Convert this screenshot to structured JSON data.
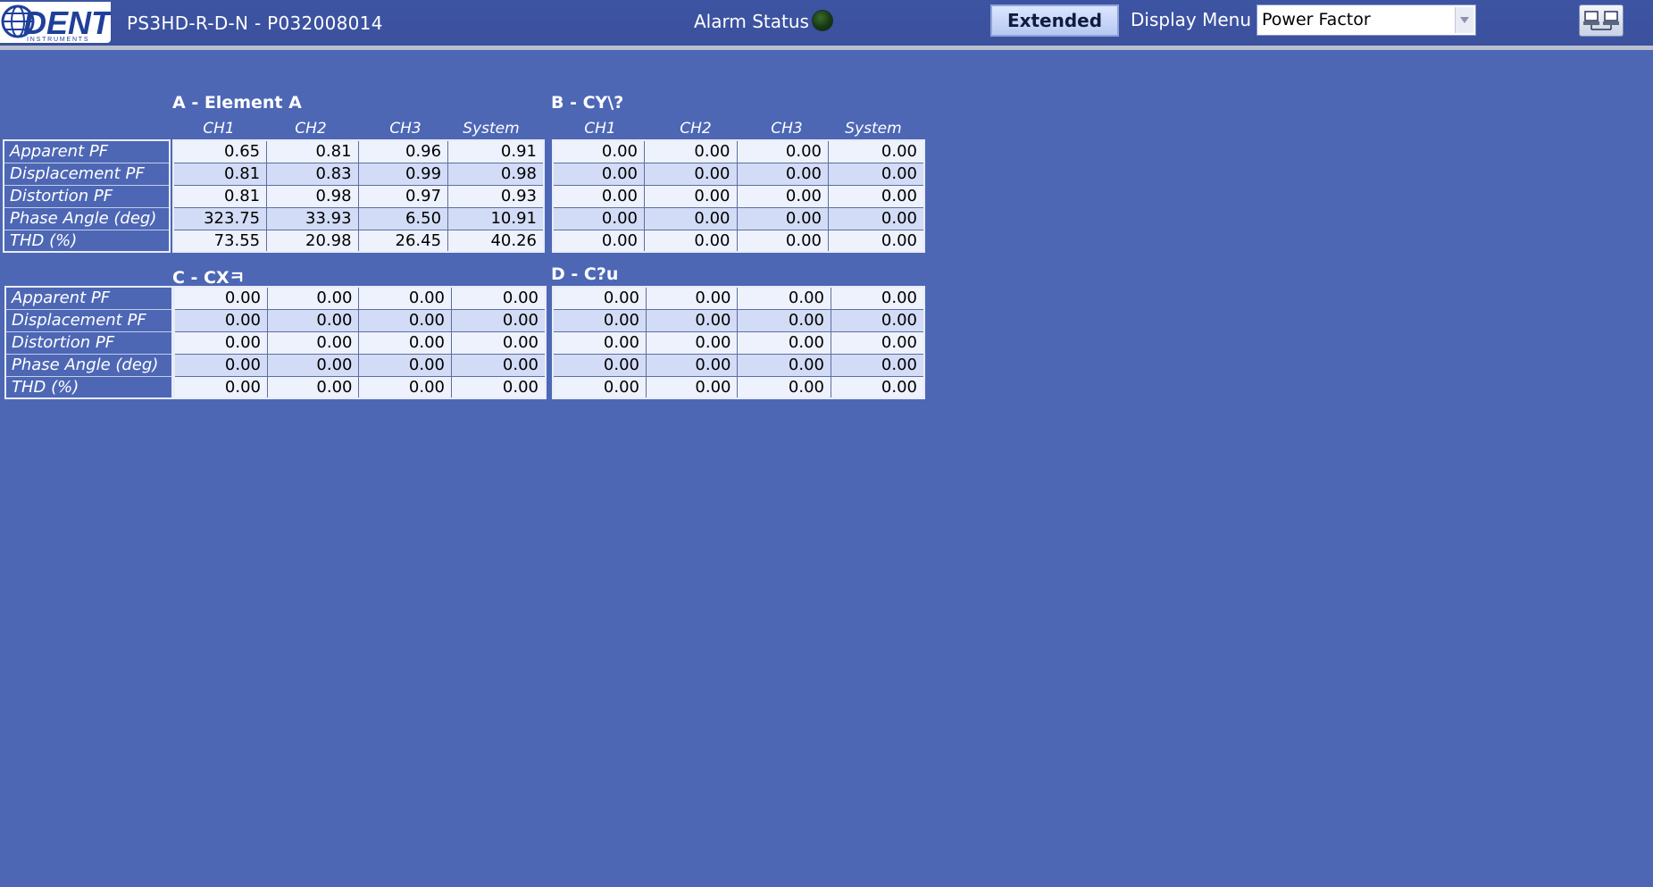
{
  "header": {
    "logo_text": "DENT",
    "logo_subtext": "INSTRUMENTS",
    "device_title": "PS3HD-R-D-N - P032008014",
    "alarm_label": "Alarm Status",
    "extended_label": "Extended",
    "display_menu_label": "Display Menu",
    "display_menu_value": "Power Factor",
    "alarm_led_color": "#173a12"
  },
  "row_labels": [
    "Apparent PF",
    "Displacement PF",
    "Distortion PF",
    "Phase Angle (deg)",
    "THD (%)"
  ],
  "col_headers": [
    "CH1",
    "CH2",
    "CH3",
    "System"
  ],
  "elements": {
    "a": {
      "title": "A - Element A",
      "rows": [
        [
          "0.65",
          "0.81",
          "0.96",
          "0.91"
        ],
        [
          "0.81",
          "0.83",
          "0.99",
          "0.98"
        ],
        [
          "0.81",
          "0.98",
          "0.97",
          "0.93"
        ],
        [
          "323.75",
          "33.93",
          "6.50",
          "10.91"
        ],
        [
          "73.55",
          "20.98",
          "26.45",
          "40.26"
        ]
      ]
    },
    "b": {
      "title": "B - CY\\?",
      "rows": [
        [
          "0.00",
          "0.00",
          "0.00",
          "0.00"
        ],
        [
          "0.00",
          "0.00",
          "0.00",
          "0.00"
        ],
        [
          "0.00",
          "0.00",
          "0.00",
          "0.00"
        ],
        [
          "0.00",
          "0.00",
          "0.00",
          "0.00"
        ],
        [
          "0.00",
          "0.00",
          "0.00",
          "0.00"
        ]
      ]
    },
    "c": {
      "title": "C - CXㅋ",
      "rows": [
        [
          "0.00",
          "0.00",
          "0.00",
          "0.00"
        ],
        [
          "0.00",
          "0.00",
          "0.00",
          "0.00"
        ],
        [
          "0.00",
          "0.00",
          "0.00",
          "0.00"
        ],
        [
          "0.00",
          "0.00",
          "0.00",
          "0.00"
        ],
        [
          "0.00",
          "0.00",
          "0.00",
          "0.00"
        ]
      ]
    },
    "d": {
      "title": "D - C?u",
      "rows": [
        [
          "0.00",
          "0.00",
          "0.00",
          "0.00"
        ],
        [
          "0.00",
          "0.00",
          "0.00",
          "0.00"
        ],
        [
          "0.00",
          "0.00",
          "0.00",
          "0.00"
        ],
        [
          "0.00",
          "0.00",
          "0.00",
          "0.00"
        ],
        [
          "0.00",
          "0.00",
          "0.00",
          "0.00"
        ]
      ]
    }
  }
}
